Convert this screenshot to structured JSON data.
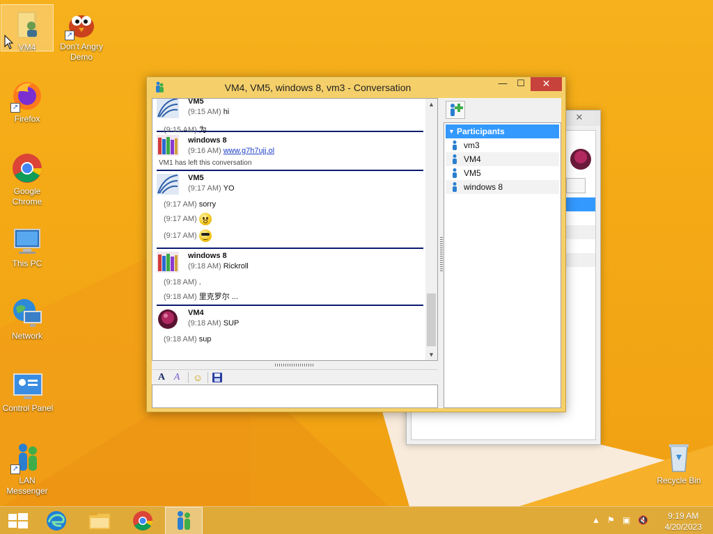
{
  "desktop": {
    "icons": [
      {
        "label": "VM4"
      },
      {
        "label": "Don't Angry Demo"
      },
      {
        "label": "Firefox"
      },
      {
        "label": "Google Chrome"
      },
      {
        "label": "This PC"
      },
      {
        "label": "Network"
      },
      {
        "label": "Control Panel"
      },
      {
        "label": "LAN Messenger"
      },
      {
        "label": "Recycle Bin"
      }
    ]
  },
  "window": {
    "title": "VM4, VM5, windows 8, vm3 - Conversation",
    "minimize": "—",
    "maximize": "☐",
    "close": "✕"
  },
  "conversation": {
    "blocks": [
      {
        "sender": "VM5",
        "first": {
          "time": "(9:15 AM)",
          "text": "hi"
        },
        "lines": [
          {
            "time": "(9:15 AM)",
            "text": "为"
          }
        ]
      },
      {
        "sender": "windows 8",
        "first": {
          "time": "(9:16 AM)",
          "link": "www.g7h7ujj.ol"
        },
        "system": "VM1 has left this conversation"
      },
      {
        "sender": "VM5",
        "first": {
          "time": "(9:17 AM)",
          "text": "YO"
        },
        "lines": [
          {
            "time": "(9:17 AM)",
            "text": "sorry"
          },
          {
            "time": "(9:17 AM)",
            "emoji": "surprised-emoji"
          },
          {
            "time": "(9:17 AM)",
            "emoji": "cool-sunglasses-emoji"
          }
        ]
      },
      {
        "sender": "windows 8",
        "first": {
          "time": "(9:18 AM)",
          "text": "Rickroll"
        },
        "lines": [
          {
            "time": "(9:18 AM)",
            "text": "."
          },
          {
            "time": "(9:18 AM)",
            "text": "里克罗尔 ..."
          }
        ]
      },
      {
        "sender": "VM4",
        "first": {
          "time": "(9:18 AM)",
          "text": "SUP"
        },
        "lines": [
          {
            "time": "(9:18 AM)",
            "text": "sup"
          }
        ]
      }
    ],
    "input_value": ""
  },
  "toolbar": {
    "font_icon": "A",
    "font_color_icon": "A",
    "emoji_icon": "☺",
    "save_icon": "💾"
  },
  "participants": {
    "header": "Participants",
    "items": [
      "vm3",
      "VM4",
      "VM5",
      "windows 8"
    ]
  },
  "taskbar": {
    "time": "9:19 AM",
    "date": "4/20/2023"
  },
  "colors": {
    "accent": "#3399ff",
    "close_red": "#c7423a",
    "separator": "#0a1a6e",
    "link": "#1a3ec7"
  }
}
